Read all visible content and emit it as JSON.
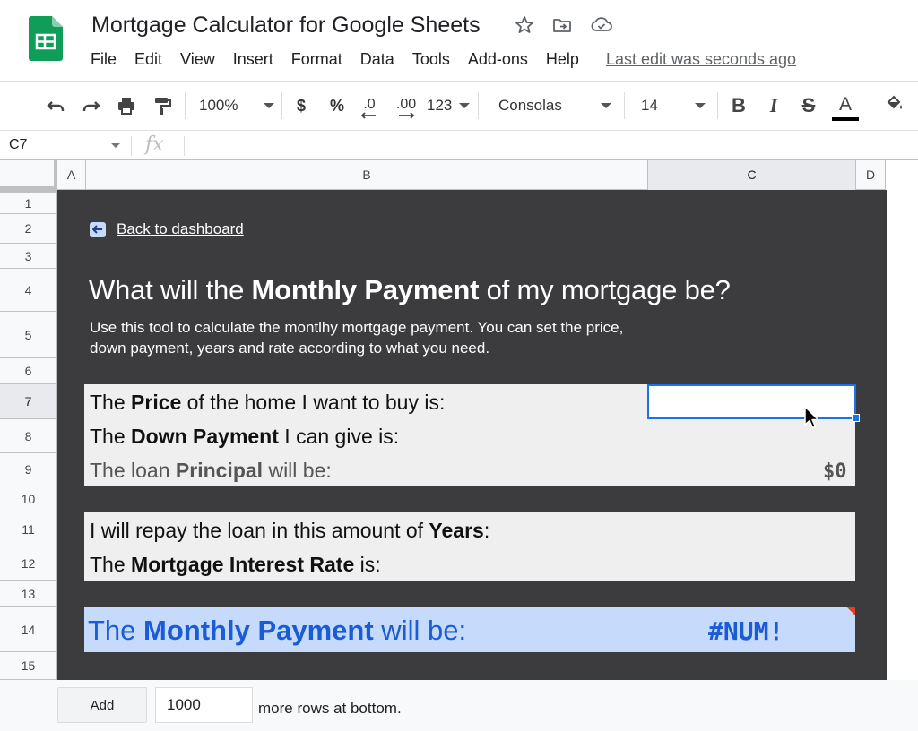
{
  "app": {
    "doc_title": "Mortgage Calculator for Google Sheets",
    "menus": [
      "File",
      "Edit",
      "View",
      "Insert",
      "Format",
      "Data",
      "Tools",
      "Add-ons",
      "Help"
    ],
    "last_edit": "Last edit was seconds ago"
  },
  "toolbar": {
    "zoom": "100%",
    "currency": "$",
    "percent": "%",
    "decrease_decimals": ".0",
    "increase_decimals": ".00",
    "more_formats": "123",
    "font": "Consolas",
    "font_size": "14",
    "text_color": "#000000"
  },
  "formula_bar": {
    "cell_ref": "C7",
    "fx": "fx",
    "value": ""
  },
  "grid": {
    "columns": [
      "A",
      "B",
      "C",
      "D"
    ],
    "selected_column": "C",
    "rows": [
      "1",
      "2",
      "3",
      "4",
      "5",
      "6",
      "7",
      "8",
      "9",
      "10",
      "11",
      "12",
      "13",
      "14",
      "15"
    ],
    "selected_row": "7"
  },
  "sheet": {
    "back_link": "Back to dashboard",
    "heading": {
      "pre": "What will the ",
      "bold": "Monthly Payment",
      "post": " of my mortgage be?"
    },
    "subtext": "Use this tool to calculate the montlhy mortgage payment. You can set the price, down payment, years and rate according to what you need.",
    "price": {
      "pre": "The ",
      "bold": "Price",
      "post": " of the home I want to buy is:",
      "value": ""
    },
    "down_payment": {
      "pre": "The ",
      "bold": "Down Payment",
      "post": " I can give is:"
    },
    "principal": {
      "pre": "The loan ",
      "bold": "Principal",
      "post": " will be:",
      "value": "$0"
    },
    "years": {
      "pre": "I will repay the loan in this amount of ",
      "bold": "Years",
      "post": ":"
    },
    "rate": {
      "pre": "The ",
      "bold": "Mortgage Interest Rate",
      "post": " is:"
    },
    "monthly_payment": {
      "pre": "The ",
      "bold": "Monthly Payment",
      "post": " will be:",
      "value": "#NUM!"
    }
  },
  "bottom": {
    "add_label": "Add",
    "rows_value": "1000",
    "rows_text": "more rows at bottom."
  },
  "colors": {
    "sheet_background": "#3c3b3d",
    "panel": "#efefef",
    "result_panel": "#c6dafc",
    "result_text": "#1a5bd6",
    "selection": "#1a73e8"
  }
}
